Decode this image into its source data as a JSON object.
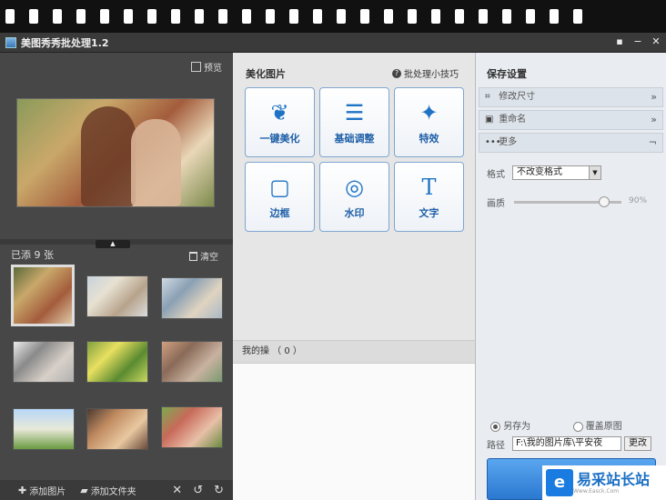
{
  "window": {
    "title": "美图秀秀批处理1.2"
  },
  "left": {
    "preview_label": "预览",
    "added_label": "已添 9 张",
    "clear_label": "清空",
    "add_picture": "添加图片",
    "add_folder": "添加文件夹"
  },
  "middle": {
    "header": "美化图片",
    "tips": "批处理小技巧",
    "tools": [
      {
        "label": "一键美化",
        "icon": "tulip-icon"
      },
      {
        "label": "基础调整",
        "icon": "sliders-icon"
      },
      {
        "label": "特效",
        "icon": "magic-wand-icon"
      },
      {
        "label": "边框",
        "icon": "frame-icon"
      },
      {
        "label": "水印",
        "icon": "watermark-icon"
      },
      {
        "label": "文字",
        "icon": "text-icon"
      }
    ],
    "my_ops": "我的操 （ 0 ）"
  },
  "right": {
    "header": "保存设置",
    "sections": [
      {
        "label": "修改尺寸"
      },
      {
        "label": "重命名"
      },
      {
        "label": "更多"
      }
    ],
    "format_label": "格式",
    "format_value": "不改变格式",
    "quality_label": "画质",
    "quality_value": "90%",
    "save_as_label": "另存为",
    "overwrite_label": "覆盖原图",
    "path_label": "路径",
    "path_value": "F:\\我的图片库\\平安夜",
    "change_label": "更改"
  },
  "watermark": {
    "text": "易采站长站",
    "sub": "Www.Easck.Com"
  },
  "colors": {
    "accent": "#1e73c4",
    "panel_dark": "#474747",
    "panel_mid": "#e6e6e6",
    "panel_right": "#e9edf2"
  }
}
